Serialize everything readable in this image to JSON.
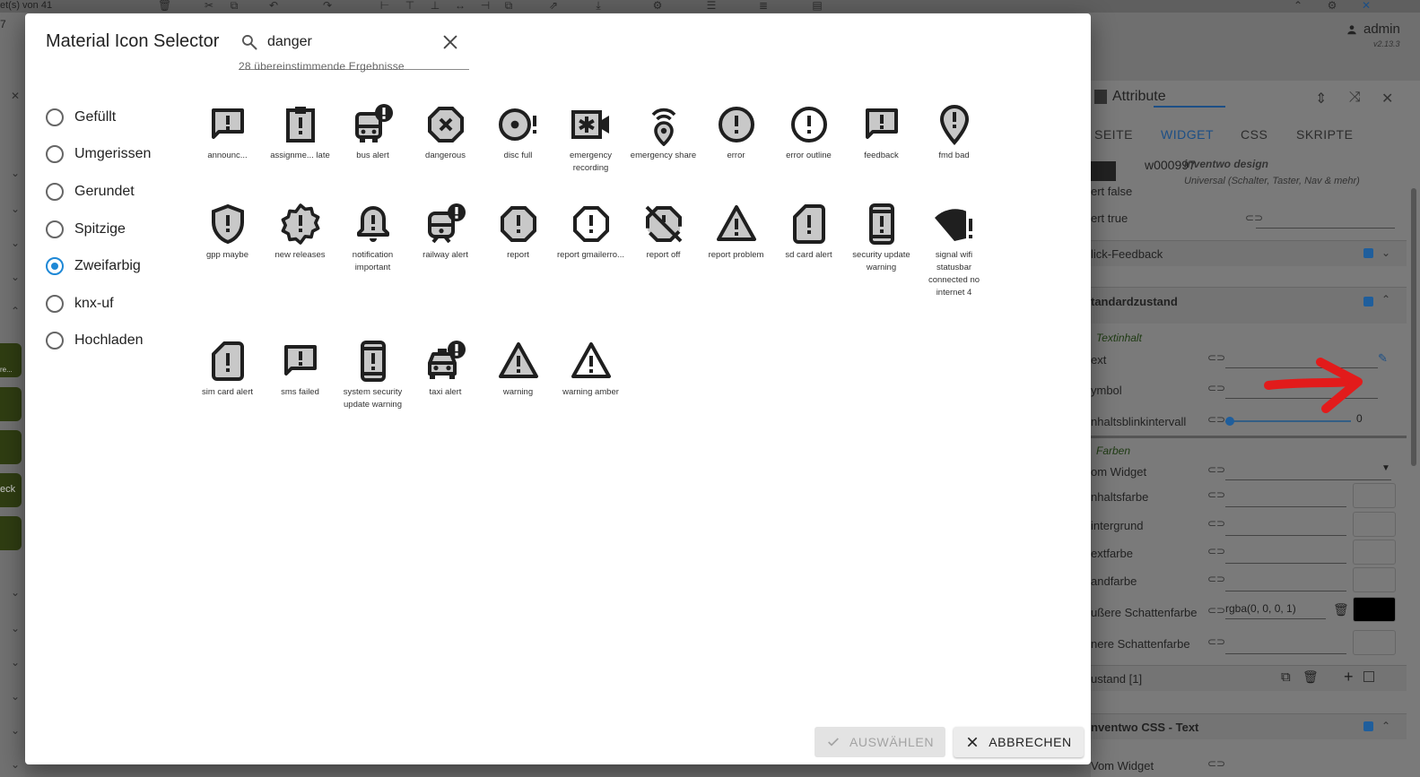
{
  "background": {
    "counter_text": "et(s) von 41",
    "left_value": "7",
    "user_name": "admin",
    "version": "v2.13.3",
    "left_swatch_labels": [
      "re...",
      "eck"
    ]
  },
  "attributes_panel": {
    "title": "Attribute",
    "tabs": [
      "SEITE",
      "WIDGET",
      "CSS",
      "SKRIPTE"
    ],
    "active_tab": "WIDGET",
    "widget_id": "w000997",
    "widget_design": "inventwo design",
    "widget_subtitle": "Universal (Schalter, Taster, Nav & mehr)",
    "rows": {
      "wert_false": "ert false",
      "wert_true": "ert true",
      "klick_feedback": "lick-Feedback",
      "standardzustand": "tandardzustand",
      "textinhalt": "Textinhalt",
      "text": "ext",
      "symbol": "ymbol",
      "blinkintervall": "nhaltsblinkintervall",
      "blinkintervall_value": "0",
      "farben": "Farben",
      "vom_widget": "om Widget",
      "inhaltsfarbe": "nhaltsfarbe",
      "hintergrund": "intergrund",
      "textfarbe": "extfarbe",
      "randfarbe": "andfarbe",
      "aeussere_schattenfarbe": "ußere Schattenfarbe",
      "aeussere_schattenfarbe_value": "rgba(0, 0, 0, 1)",
      "innere_schattenfarbe": "nere Schattenfarbe",
      "zustand": "ustand [1]",
      "inventwo_css_text": "nventwo CSS - Text",
      "vom_widget_2": "Vom Widget"
    },
    "colors": {
      "accent": "#1c4f86",
      "arrow": "#e21b1b"
    }
  },
  "dialog": {
    "title": "Material Icon Selector",
    "search": {
      "value": "danger",
      "placeholder": ""
    },
    "results_text": "28 übereinstimmende Ergebnisse",
    "styles": [
      {
        "label": "Gefüllt",
        "selected": false
      },
      {
        "label": "Umgerissen",
        "selected": false
      },
      {
        "label": "Gerundet",
        "selected": false
      },
      {
        "label": "Spitzige",
        "selected": false
      },
      {
        "label": "Zweifarbig",
        "selected": true
      },
      {
        "label": "knx-uf",
        "selected": false
      },
      {
        "label": "Hochladen",
        "selected": false
      }
    ],
    "icons": [
      {
        "name": "announc...",
        "icon": "announcement-icon"
      },
      {
        "name": "assignme... late",
        "icon": "assignment-late-icon"
      },
      {
        "name": "bus alert",
        "icon": "bus-alert-icon"
      },
      {
        "name": "dangerous",
        "icon": "dangerous-icon"
      },
      {
        "name": "disc full",
        "icon": "disc-full-icon"
      },
      {
        "name": "emergency recording",
        "icon": "emergency-recording-icon"
      },
      {
        "name": "emergency share",
        "icon": "emergency-share-icon"
      },
      {
        "name": "error",
        "icon": "error-icon"
      },
      {
        "name": "error outline",
        "icon": "error-outline-icon"
      },
      {
        "name": "feedback",
        "icon": "feedback-icon"
      },
      {
        "name": "fmd bad",
        "icon": "fmd-bad-icon"
      },
      {
        "name": "gpp maybe",
        "icon": "gpp-maybe-icon"
      },
      {
        "name": "new releases",
        "icon": "new-releases-icon"
      },
      {
        "name": "notification important",
        "icon": "notification-important-icon"
      },
      {
        "name": "railway alert",
        "icon": "railway-alert-icon"
      },
      {
        "name": "report",
        "icon": "report-icon"
      },
      {
        "name": "report gmailerro...",
        "icon": "report-gmailerrorred-icon"
      },
      {
        "name": "report off",
        "icon": "report-off-icon"
      },
      {
        "name": "report problem",
        "icon": "report-problem-icon"
      },
      {
        "name": "sd card alert",
        "icon": "sd-card-alert-icon"
      },
      {
        "name": "security update warning",
        "icon": "security-update-warning-icon"
      },
      {
        "name": "signal wifi statusbar connected no internet 4",
        "icon": "signal-wifi-no-internet-icon"
      },
      {
        "name": "sim card alert",
        "icon": "sim-card-alert-icon"
      },
      {
        "name": "sms failed",
        "icon": "sms-failed-icon"
      },
      {
        "name": "system security update warning",
        "icon": "system-security-update-warning-icon"
      },
      {
        "name": "taxi alert",
        "icon": "taxi-alert-icon"
      },
      {
        "name": "warning",
        "icon": "warning-icon"
      },
      {
        "name": "warning amber",
        "icon": "warning-amber-icon"
      }
    ],
    "buttons": {
      "select": "AUSWÄHLEN",
      "cancel": "ABBRECHEN"
    },
    "colors": {
      "radio_selected": "#1e88d6",
      "icon_dark": "#1f1f1f",
      "icon_tone": "#c8c8c8"
    }
  }
}
